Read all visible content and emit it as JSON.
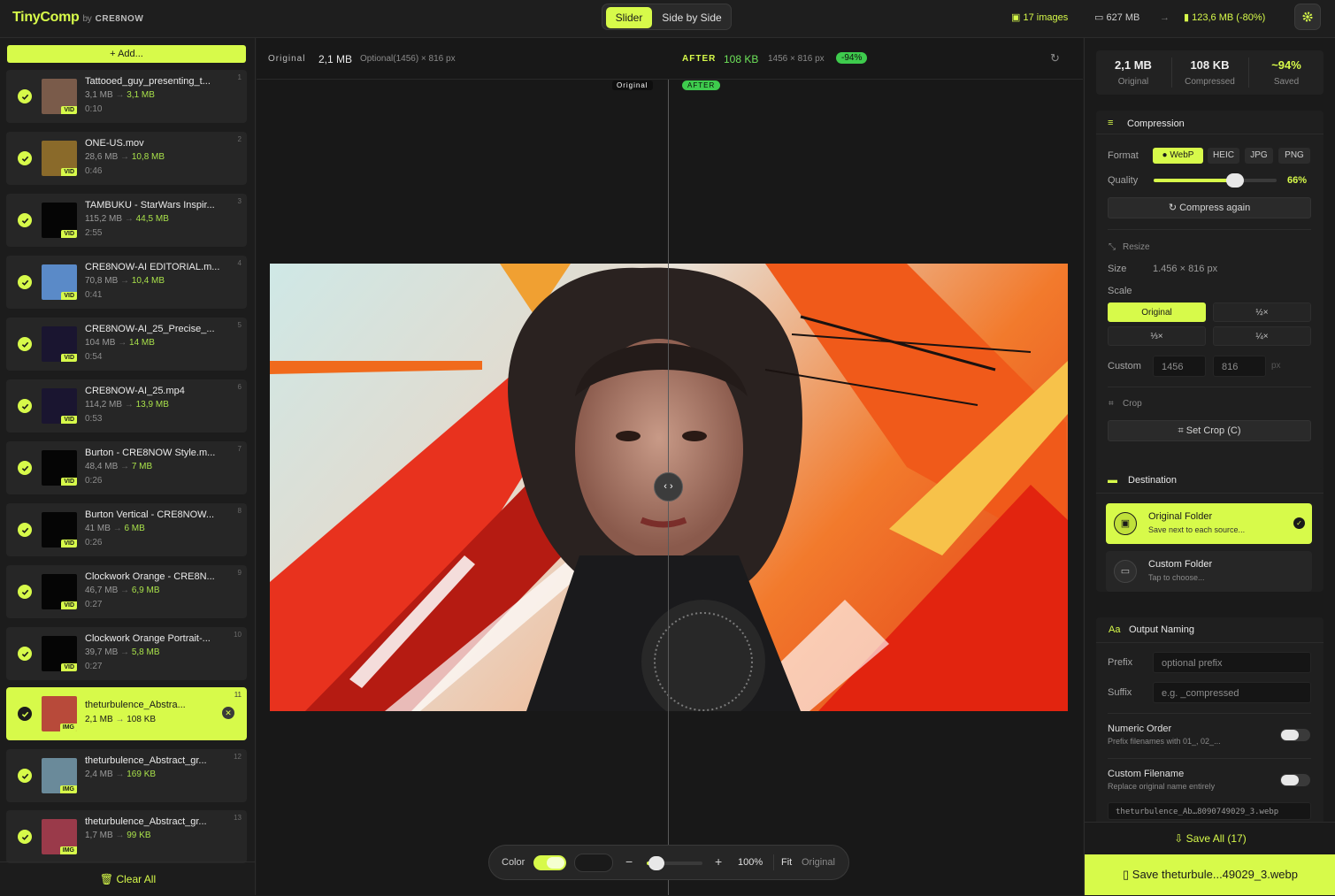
{
  "app": {
    "brand": "TinyComp",
    "by": "by",
    "maker": "CRE8NOW"
  },
  "view_modes": {
    "slider": "Slider",
    "side": "Side by Side"
  },
  "stats": {
    "images": "17 images",
    "total": "627 MB",
    "compressed": "123,6 MB (-80%)"
  },
  "sidebar": {
    "add": "Add...",
    "clear": "Clear All",
    "items": [
      {
        "name": "Tattooed_guy_presenting_t...",
        "orig": "3,1 MB",
        "new": "3,1 MB",
        "dur": "0:10",
        "num": "1",
        "kind": "VID"
      },
      {
        "name": "ONE-US.mov",
        "orig": "28,6 MB",
        "new": "10,8 MB",
        "dur": "0:46",
        "num": "2",
        "kind": "VID"
      },
      {
        "name": "TAMBUKU - StarWars Inspir...",
        "orig": "115,2 MB",
        "new": "44,5 MB",
        "dur": "2:55",
        "num": "3",
        "kind": "VID"
      },
      {
        "name": "CRE8NOW-AI EDITORIAL.m...",
        "orig": "70,8 MB",
        "new": "10,4 MB",
        "dur": "0:41",
        "num": "4",
        "kind": "VID"
      },
      {
        "name": "CRE8NOW-AI_25_Precise_...",
        "orig": "104 MB",
        "new": "14 MB",
        "dur": "0:54",
        "num": "5",
        "kind": "VID"
      },
      {
        "name": "CRE8NOW-AI_25.mp4",
        "orig": "114,2 MB",
        "new": "13,9 MB",
        "dur": "0:53",
        "num": "6",
        "kind": "VID"
      },
      {
        "name": "Burton - CRE8NOW Style.m...",
        "orig": "48,4 MB",
        "new": "7 MB",
        "dur": "0:26",
        "num": "7",
        "kind": "VID"
      },
      {
        "name": "Burton Vertical - CRE8NOW...",
        "orig": "41 MB",
        "new": "6 MB",
        "dur": "0:26",
        "num": "8",
        "kind": "VID"
      },
      {
        "name": "Clockwork Orange - CRE8N...",
        "orig": "46,7 MB",
        "new": "6,9 MB",
        "dur": "0:27",
        "num": "9",
        "kind": "VID"
      },
      {
        "name": "Clockwork Orange Portrait-...",
        "orig": "39,7 MB",
        "new": "5,8 MB",
        "dur": "0:27",
        "num": "10",
        "kind": "VID"
      },
      {
        "name": "theturbulence_Abstra...",
        "orig": "2,1 MB",
        "new": "108 KB",
        "dur": "",
        "num": "11",
        "kind": "IMG"
      },
      {
        "name": "theturbulence_Abstract_gr...",
        "orig": "2,4 MB",
        "new": "169 KB",
        "dur": "",
        "num": "12",
        "kind": "IMG"
      },
      {
        "name": "theturbulence_Abstract_gr...",
        "orig": "1,7 MB",
        "new": "99 KB",
        "dur": "",
        "num": "13",
        "kind": "IMG"
      }
    ]
  },
  "viewer": {
    "orig_label": "Original",
    "orig_size": "2,1 MB",
    "orig_dims": "Optional(1456) × 816 px",
    "after_label": "AFTER",
    "after_size": "108 KB",
    "after_dims": "1456 × 816 px",
    "after_pct": "-94%",
    "tag_orig": "Original",
    "tag_after": "AFTER",
    "bar": {
      "color": "Color",
      "zoom": "100%",
      "fit": "Fit",
      "original": "Original"
    }
  },
  "summary": {
    "orig": "2,1 MB",
    "orig_l": "Original",
    "comp": "108 KB",
    "comp_l": "Compressed",
    "saved": "~94%",
    "saved_l": "Saved"
  },
  "compression": {
    "title": "Compression",
    "format_l": "Format",
    "formats": [
      "WebP",
      "HEIC",
      "JPG",
      "PNG"
    ],
    "quality_l": "Quality",
    "quality": "66%",
    "quality_value": 0.66,
    "again": "Compress again",
    "resize": "Resize",
    "size_l": "Size",
    "size": "1.456 × 816 px",
    "scale_l": "Scale",
    "scales": [
      "Original",
      "½×",
      "⅓×",
      "¼×"
    ],
    "custom_l": "Custom",
    "w": "1456",
    "h": "816",
    "px": "px",
    "crop": "Crop",
    "setcrop": "Set Crop (C)"
  },
  "destination": {
    "title": "Destination",
    "o_title": "Original Folder",
    "o_sub": "Save next to each source...",
    "c_title": "Custom Folder",
    "c_sub": "Tap to choose..."
  },
  "naming": {
    "title": "Output Naming",
    "prefix_l": "Prefix",
    "prefix_ph": "optional prefix",
    "suffix_l": "Suffix",
    "suffix_ph": "e.g. _compressed",
    "num_t": "Numeric Order",
    "num_s": "Prefix filenames with 01_, 02_...",
    "cf_t": "Custom Filename",
    "cf_s": "Replace original name entirely",
    "fname": "theturbulence_Ab…8090749029_3.webp"
  },
  "footer": {
    "saveall": "Save All (17)",
    "save": "Save theturbule...49029_3.webp"
  },
  "colors": {
    "accent": "#d7fa4a",
    "green": "#3ecb4d"
  }
}
